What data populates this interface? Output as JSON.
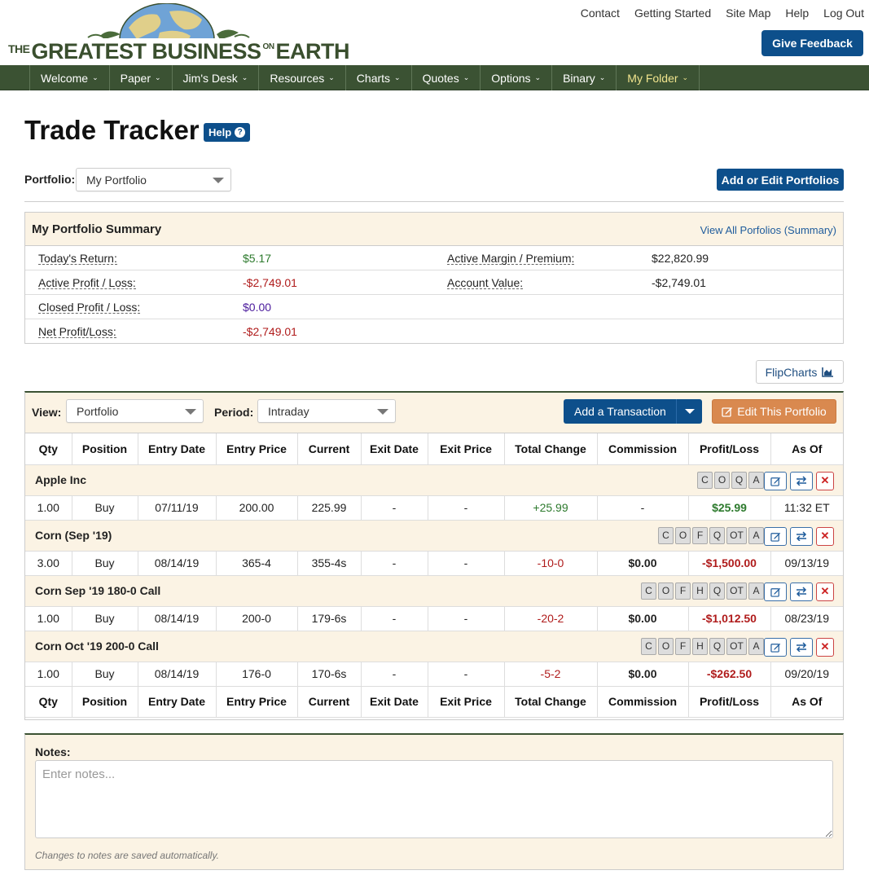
{
  "header": {
    "logo": {
      "the": "THE",
      "greatest": "GREATEST BUSINESS",
      "on": "ON",
      "earth": "EARTH"
    },
    "links": [
      "Contact",
      "Getting Started",
      "Site Map",
      "Help",
      "Log Out"
    ],
    "feedback_label": "Give Feedback"
  },
  "nav": {
    "items": [
      {
        "label": "Welcome"
      },
      {
        "label": "Paper"
      },
      {
        "label": "Jim's Desk"
      },
      {
        "label": "Resources"
      },
      {
        "label": "Charts"
      },
      {
        "label": "Quotes"
      },
      {
        "label": "Options"
      },
      {
        "label": "Binary"
      },
      {
        "label": "My Folder",
        "active": true
      }
    ],
    "caret": "⌄"
  },
  "page": {
    "title": "Trade Tracker",
    "help_label": "Help"
  },
  "portfolio": {
    "label": "Portfolio:",
    "selected": "My Portfolio",
    "add_edit_label": "Add or Edit Portfolios"
  },
  "summary": {
    "title": "My Portfolio Summary",
    "link": "View All Porfolios (Summary)",
    "rows": [
      {
        "l1": "Today's Return:",
        "v1": "$5.17",
        "l2": "Active Margin / Premium:",
        "v2": "$22,820.99"
      },
      {
        "l1": "Active Profit / Loss:",
        "v1": "-$2,749.01",
        "l2": "Account Value:",
        "v2": "-$2,749.01"
      },
      {
        "l1": "Closed Profit / Loss:",
        "v1": "$0.00",
        "l2": "",
        "v2": ""
      },
      {
        "l1": "Net Profit/Loss:",
        "v1": "-$2,749.01",
        "l2": "",
        "v2": ""
      }
    ]
  },
  "flipcharts_label": "FlipCharts",
  "toolbar": {
    "view_label": "View:",
    "view_selected": "Portfolio",
    "period_label": "Period:",
    "period_selected": "Intraday",
    "add_label": "Add a Transaction",
    "edit_label": "Edit This Portfolio"
  },
  "table": {
    "columns": [
      "Qty",
      "Position",
      "Entry Date",
      "Entry Price",
      "Current",
      "Exit Date",
      "Exit Price",
      "Total Change",
      "Commission",
      "Profit/Loss",
      "As Of"
    ],
    "groups": [
      {
        "name": "Apple Inc",
        "letters": [
          "C",
          "O",
          "Q",
          "A"
        ],
        "row": {
          "qty": "1.00",
          "position": "Buy",
          "entry_date": "07/11/19",
          "entry_price": "200.00",
          "current": "225.99",
          "exit_date": "-",
          "exit_price": "-",
          "total_change": "+25.99",
          "commission": "-",
          "pl": "$25.99",
          "as_of": "11:32 ET"
        }
      },
      {
        "name": "Corn (Sep '19)",
        "letters": [
          "C",
          "O",
          "F",
          "Q",
          "OT",
          "A"
        ],
        "row": {
          "qty": "3.00",
          "position": "Buy",
          "entry_date": "08/14/19",
          "entry_price": "365-4",
          "current": "355-4s",
          "exit_date": "-",
          "exit_price": "-",
          "total_change": "-10-0",
          "commission": "$0.00",
          "pl": "-$1,500.00",
          "as_of": "09/13/19"
        }
      },
      {
        "name": "Corn Sep '19 180-0 Call",
        "letters": [
          "C",
          "O",
          "F",
          "H",
          "Q",
          "OT",
          "A"
        ],
        "row": {
          "qty": "1.00",
          "position": "Buy",
          "entry_date": "08/14/19",
          "entry_price": "200-0",
          "current": "179-6s",
          "exit_date": "-",
          "exit_price": "-",
          "total_change": "-20-2",
          "commission": "$0.00",
          "pl": "-$1,012.50",
          "as_of": "08/23/19"
        }
      },
      {
        "name": "Corn Oct '19 200-0 Call",
        "letters": [
          "C",
          "O",
          "F",
          "H",
          "Q",
          "OT",
          "A"
        ],
        "row": {
          "qty": "1.00",
          "position": "Buy",
          "entry_date": "08/14/19",
          "entry_price": "176-0",
          "current": "170-6s",
          "exit_date": "-",
          "exit_price": "-",
          "total_change": "-5-2",
          "commission": "$0.00",
          "pl": "-$262.50",
          "as_of": "09/20/19"
        }
      }
    ]
  },
  "notes": {
    "label": "Notes:",
    "placeholder": "Enter notes...",
    "hint": "Changes to notes are saved automatically."
  },
  "colors": {
    "nav_bg": "#3b5233",
    "primary": "#0d4f8b",
    "edit": "#d9894f",
    "cream": "#fbf3e4",
    "gain": "#2d7a2d",
    "loss": "#b01c1c"
  }
}
